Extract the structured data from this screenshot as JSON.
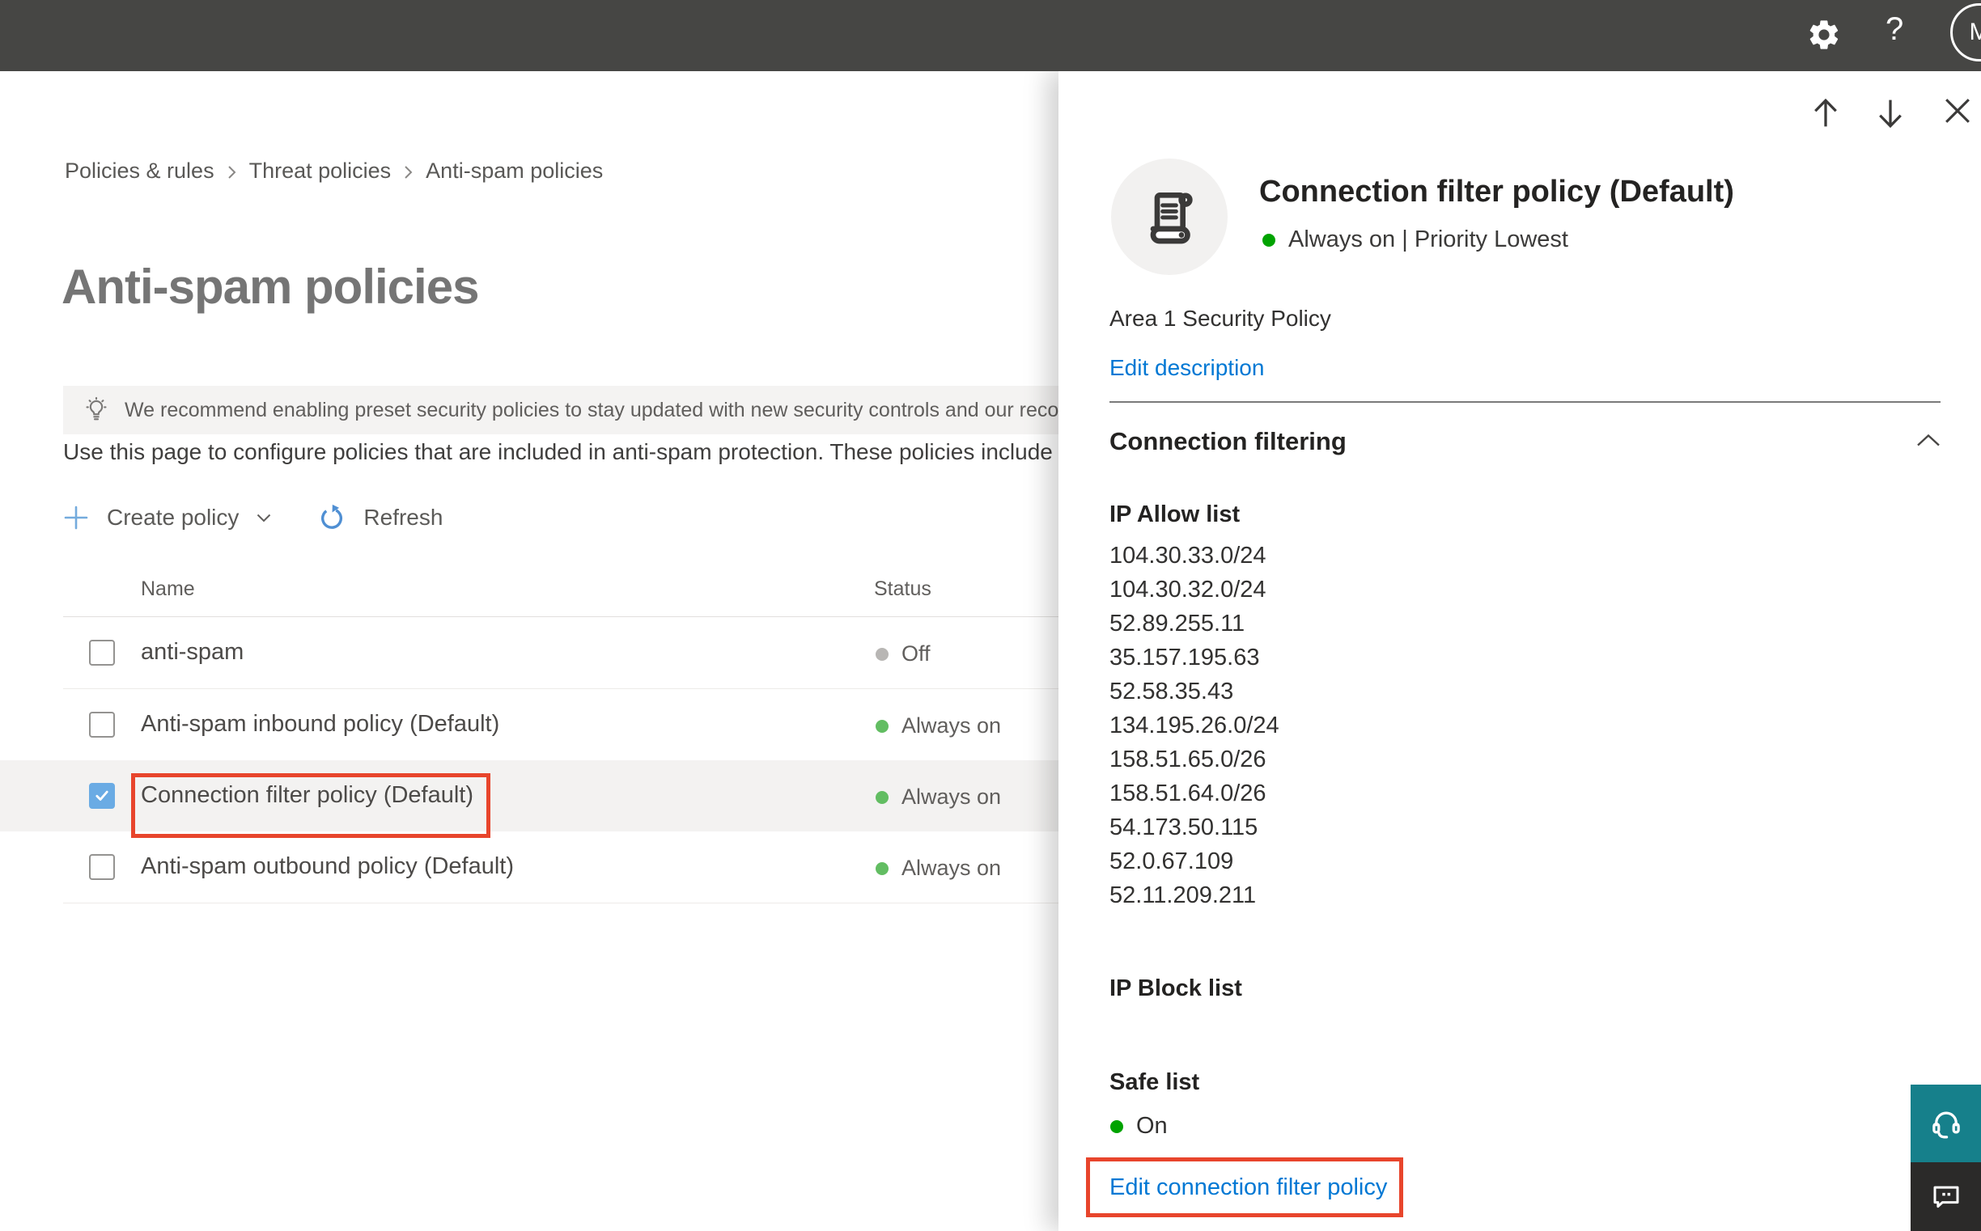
{
  "topbar": {
    "avatar_initial": "M",
    "help_label": "?"
  },
  "breadcrumb": {
    "items": [
      "Policies & rules",
      "Threat policies",
      "Anti-spam policies"
    ]
  },
  "page": {
    "title": "Anti-spam policies",
    "banner_text": "We recommend enabling preset security policies to stay updated with new security controls and our recomme",
    "intro_text": "Use this page to configure policies that are included in anti-spam protection. These policies include",
    "toolbar": {
      "create_policy_label": "Create policy",
      "refresh_label": "Refresh"
    }
  },
  "table": {
    "columns": {
      "name": "Name",
      "status": "Status"
    },
    "rows": [
      {
        "name": "anti-spam",
        "status": "Off",
        "dot_color": "#b8b6b4",
        "checked": false
      },
      {
        "name": "Anti-spam inbound policy (Default)",
        "status": "Always on",
        "dot_color": "#62bd62",
        "checked": false
      },
      {
        "name": "Connection filter policy (Default)",
        "status": "Always on",
        "dot_color": "#62bd62",
        "checked": true
      },
      {
        "name": "Anti-spam outbound policy (Default)",
        "status": "Always on",
        "dot_color": "#62bd62",
        "checked": false
      }
    ]
  },
  "flyout": {
    "title": "Connection filter policy (Default)",
    "status_line": "Always on | Priority Lowest",
    "status_dot_color": "#00a300",
    "description": "Area 1 Security Policy",
    "edit_description_label": "Edit description",
    "section": {
      "title": "Connection filtering"
    },
    "ip_allow": {
      "label": "IP Allow list",
      "ips": [
        "104.30.33.0/24",
        "104.30.32.0/24",
        "52.89.255.11",
        "35.157.195.63",
        "52.58.35.43",
        "134.195.26.0/24",
        "158.51.65.0/26",
        "158.51.64.0/26",
        "54.173.50.115",
        "52.0.67.109",
        "52.11.209.211"
      ]
    },
    "ip_block": {
      "label": "IP Block list"
    },
    "safe_list": {
      "label": "Safe list",
      "status": "On",
      "dot_color": "#00a300"
    },
    "edit_policy_label": "Edit connection filter policy"
  },
  "colors": {
    "accent": "#0078d4",
    "tutorial_highlight": "#e8452c",
    "topbar_bg": "#464644",
    "support_teal": "#16808b",
    "status_on_green": "#62bd62",
    "status_off_gray": "#b8b6b4",
    "flyout_on_green": "#00a300"
  },
  "icons": [
    "gear-icon",
    "help-icon",
    "avatar",
    "lightbulb-icon",
    "plus-icon",
    "chevron-down-icon",
    "refresh-icon",
    "checkmark-icon",
    "scroll-policy-icon",
    "arrow-up-icon",
    "arrow-down-icon",
    "close-icon",
    "chevron-up-icon",
    "breadcrumb-chevron-icon",
    "headset-icon",
    "feedback-icon"
  ]
}
